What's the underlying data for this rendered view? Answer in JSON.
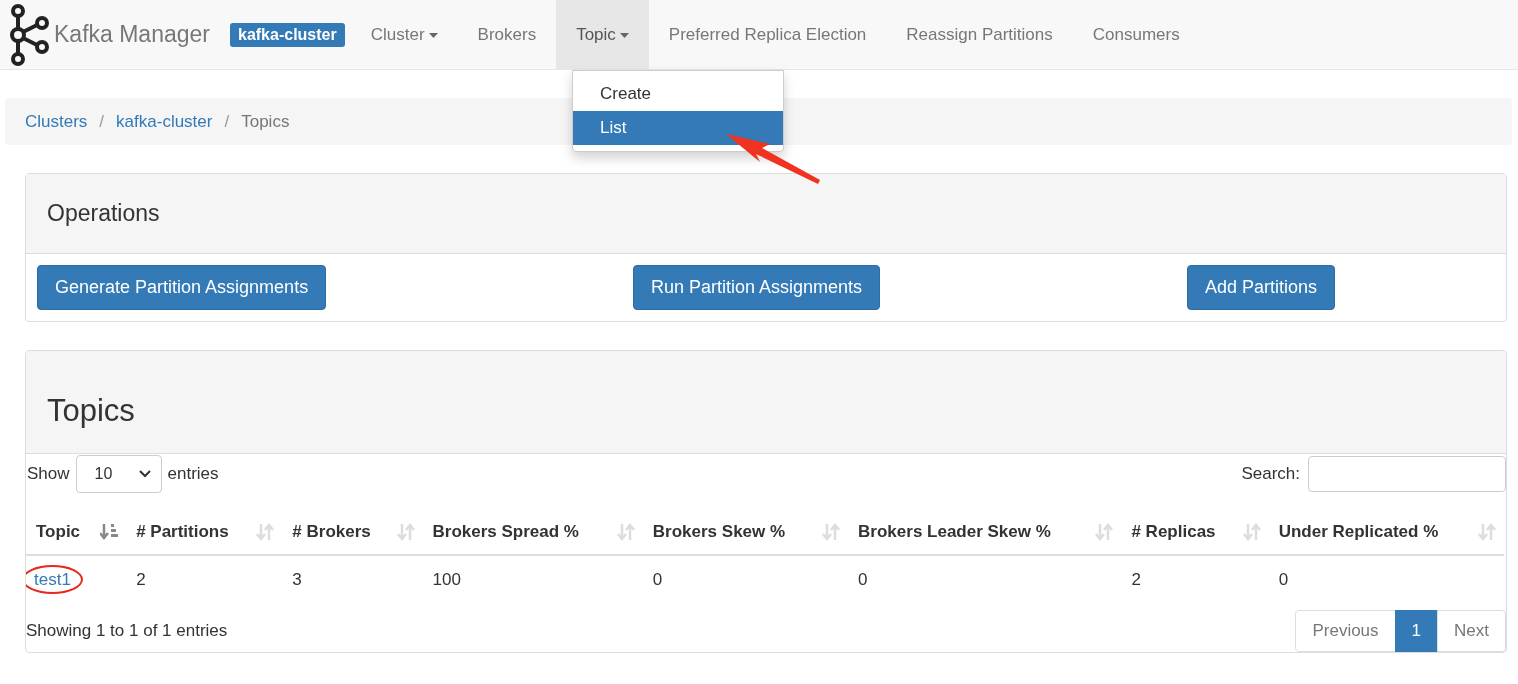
{
  "navbar": {
    "brand": "Kafka Manager",
    "cluster_badge": "kafka-cluster",
    "items": [
      {
        "label": "Cluster",
        "dropdown": true,
        "selected": false
      },
      {
        "label": "Brokers",
        "dropdown": false,
        "selected": false
      },
      {
        "label": "Topic",
        "dropdown": true,
        "selected": true
      },
      {
        "label": "Preferred Replica Election",
        "dropdown": false,
        "selected": false
      },
      {
        "label": "Reassign Partitions",
        "dropdown": false,
        "selected": false
      },
      {
        "label": "Consumers",
        "dropdown": false,
        "selected": false
      }
    ],
    "dropdown_menu": [
      {
        "label": "Create",
        "selected": false
      },
      {
        "label": "List",
        "selected": true
      }
    ]
  },
  "breadcrumb": [
    {
      "label": "Clusters",
      "kind": "link"
    },
    {
      "separator": "/",
      "label": "kafka-cluster",
      "kind": "link"
    },
    {
      "separator": "/",
      "label": "Topics",
      "kind": "current"
    }
  ],
  "operations": {
    "title": "Operations",
    "buttons": [
      "Generate Partition Assignments",
      "Run Partition Assignments",
      "Add Partitions"
    ]
  },
  "topics": {
    "title": "Topics",
    "show_label": "Show",
    "page_length": "10",
    "entries_label": "entries",
    "search_label": "Search:",
    "columns": [
      {
        "label": "Topic",
        "sorted": true
      },
      {
        "label": "# Partitions",
        "sorted": false
      },
      {
        "label": "# Brokers",
        "sorted": false
      },
      {
        "label": "Brokers Spread %",
        "sorted": false
      },
      {
        "label": "Brokers Skew %",
        "sorted": false
      },
      {
        "label": "Brokers Leader Skew %",
        "sorted": false
      },
      {
        "label": "# Replicas",
        "sorted": false
      },
      {
        "label": "Under Replicated %",
        "sorted": false
      }
    ],
    "rows": [
      [
        "test1",
        "2",
        "3",
        "100",
        "0",
        "0",
        "2",
        "0"
      ]
    ],
    "info": "Showing 1 to 1 of 1 entries",
    "pagination": [
      {
        "label": "Previous",
        "disabled": true,
        "selected": false
      },
      {
        "label": "1",
        "disabled": false,
        "selected": true
      },
      {
        "label": "Next",
        "disabled": true,
        "selected": false
      }
    ]
  }
}
